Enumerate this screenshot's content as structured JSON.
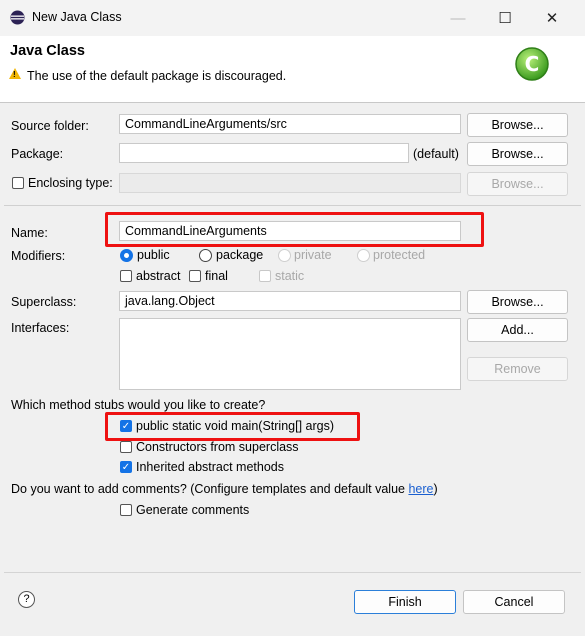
{
  "window": {
    "title": "New Java Class"
  },
  "header": {
    "title": "Java Class",
    "message": "The use of the default package is discouraged."
  },
  "form": {
    "source_folder": {
      "label": "Source folder:",
      "value": "CommandLineArguments/src"
    },
    "package": {
      "label": "Package:",
      "value": "",
      "default_label": "(default)"
    },
    "enclosing": {
      "label": "Enclosing type:",
      "value": ""
    },
    "name": {
      "label": "Name:",
      "value": "CommandLineArguments"
    },
    "modifiers": {
      "label": "Modifiers:",
      "radios": [
        "public",
        "package",
        "private",
        "protected"
      ],
      "selected": "public",
      "checks": [
        "abstract",
        "final",
        "static"
      ]
    },
    "superclass": {
      "label": "Superclass:",
      "value": "java.lang.Object"
    },
    "interfaces": {
      "label": "Interfaces:"
    },
    "stubs_question": "Which method stubs would you like to create?",
    "stubs": [
      {
        "label": "public static void main(String[] args)",
        "checked": true
      },
      {
        "label": "Constructors from superclass",
        "checked": false
      },
      {
        "label": "Inherited abstract methods",
        "checked": true
      }
    ],
    "comments_question": "Do you want to add comments? (Configure templates and default value ",
    "comments_link": "here",
    "comments_close": ")",
    "generate_comments": "Generate comments"
  },
  "buttons": {
    "browse": "Browse...",
    "add": "Add...",
    "remove": "Remove",
    "finish": "Finish",
    "cancel": "Cancel"
  },
  "icons": {
    "help": "?",
    "check": "✓",
    "minimize": "—",
    "maximize": "☐",
    "close": "✕"
  },
  "colors": {
    "accent": "#1473e6",
    "highlight": "#ee1111",
    "link": "#1a5fd0"
  }
}
